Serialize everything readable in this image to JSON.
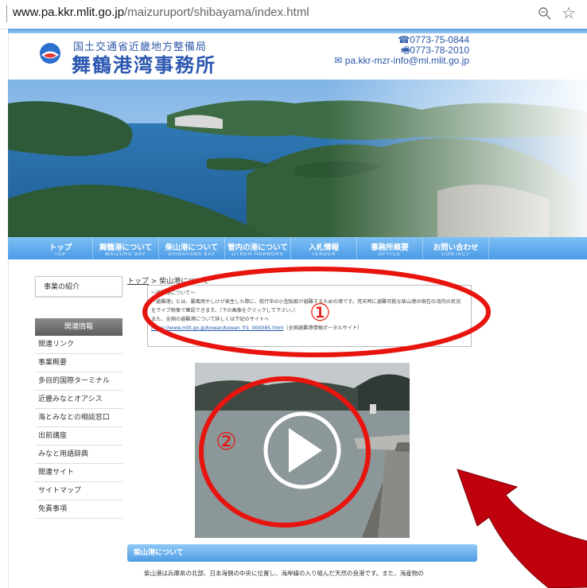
{
  "browser": {
    "url_domain": "www.pa.kkr.mlit.go.jp",
    "url_path": "/maizuruport/shibayama/index.html"
  },
  "header": {
    "org_small": "国土交通省近畿地方整備局",
    "org_big": "舞鶴港湾事務所",
    "phone": "☎0773-75-0844",
    "fax": "🖷0773-78-2010",
    "email": "pa.kkr-mzr-info@ml.mlit.go.jp"
  },
  "nav": [
    {
      "jp": "トップ",
      "en": "TOP"
    },
    {
      "jp": "舞鶴港について",
      "en": "MAIZURU BAY"
    },
    {
      "jp": "柴山港について",
      "en": "SHIBAYAMA BAY"
    },
    {
      "jp": "管内の港について",
      "en": "OTHER HARBORS"
    },
    {
      "jp": "入札情報",
      "en": "TENDER"
    },
    {
      "jp": "事務所概要",
      "en": "OFFICE"
    },
    {
      "jp": "お問い合わせ",
      "en": "CONTACT"
    }
  ],
  "sidebar": {
    "intro_label": "事業の紹介",
    "related_heading": "関連情報",
    "items": [
      "関連リンク",
      "事業概要",
      "多目的国際ターミナル",
      "近畿みなとオアシス",
      "海とみなとの相談窓口",
      "出前講座",
      "みなと用語辞典",
      "関連サイト",
      "サイトマップ",
      "免責事項"
    ]
  },
  "breadcrumb": {
    "home": "トップ",
    "separator": " > ",
    "current": "柴山港について"
  },
  "infobox": {
    "line1": "～避難港について～",
    "line2": "「避難港」とは、暴風雨やしけが発生した際に、航行中の小型船舶が避難するための港です。荒天時に避難可能な柴山港の現在の湾内の状況",
    "line3": "をライブ映像で確認できます。（下の画像をクリックして下さい。）",
    "line4": "また、全国の避難港について詳しくは下記のサイトへ",
    "link": "https://www.mlit.go.jp/kowan/kowan_fr1_000085.html",
    "link_note": "（全国避難港情報ポータルサイト）"
  },
  "annotations": {
    "marker1": "①",
    "marker2": "②"
  },
  "section": {
    "title": "柴山港について",
    "body": "柴山港は兵庫県の北部、日本海側の中央に位置し、海岸線の入り組んだ天然の良港です。また、海産物の"
  },
  "colors": {
    "nav_blue": "#4a9be6",
    "annotation_red": "#e8140e",
    "brand_blue": "#2b57b0"
  }
}
